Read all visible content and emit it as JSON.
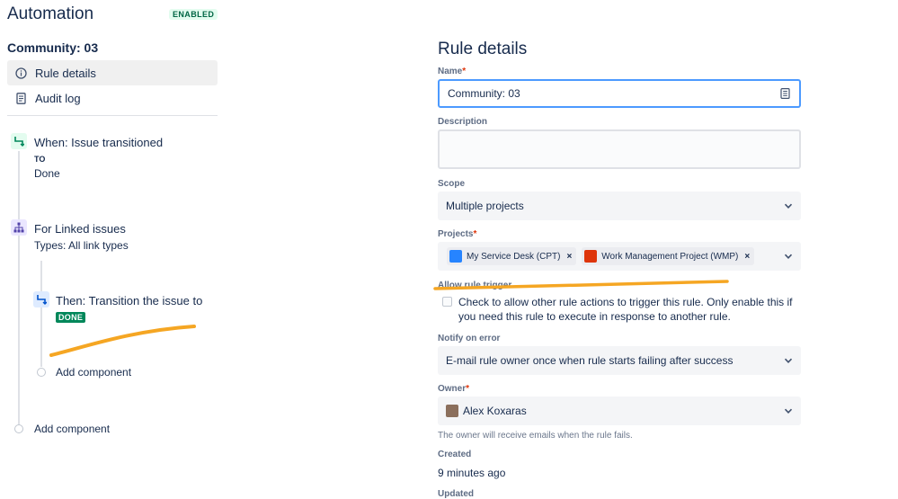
{
  "app": {
    "title": "Automation",
    "status_badge": "ENABLED"
  },
  "sidebar": {
    "rule_name": "Community: 03",
    "nav": [
      {
        "label": "Rule details",
        "icon": "info-icon"
      },
      {
        "label": "Audit log",
        "icon": "document-icon"
      }
    ]
  },
  "components": {
    "trigger": {
      "title": "When: Issue transitioned",
      "to_label": "TO",
      "to_value": "Done",
      "icon": "transition-icon"
    },
    "branch": {
      "title": "For Linked issues",
      "subtitle": "Types: All link types",
      "icon": "branch-icon"
    },
    "action": {
      "title": "Then: Transition the issue to",
      "status": "DONE",
      "icon": "transition-icon"
    },
    "add_inner": "Add component",
    "add_outer": "Add component"
  },
  "details": {
    "title": "Rule details",
    "name": {
      "label": "Name",
      "value": "Community: 03"
    },
    "description": {
      "label": "Description",
      "value": ""
    },
    "scope": {
      "label": "Scope",
      "value": "Multiple projects"
    },
    "projects": {
      "label": "Projects",
      "items": [
        {
          "label": "My Service Desk (CPT)",
          "color": "#2684ff"
        },
        {
          "label": "Work Management Project (WMP)",
          "color": "#de350b"
        }
      ]
    },
    "allow_trigger": {
      "label": "Allow rule trigger",
      "help": "Check to allow other rule actions to trigger this rule. Only enable this if you need this rule to execute in response to another rule.",
      "checked": false
    },
    "notify": {
      "label": "Notify on error",
      "value": "E-mail rule owner once when rule starts failing after success"
    },
    "owner": {
      "label": "Owner",
      "value": "Alex Koxaras",
      "note": "The owner will receive emails when the rule fails."
    },
    "created": {
      "label": "Created",
      "value": "9 minutes ago"
    },
    "updated": {
      "label": "Updated"
    }
  },
  "colors": {
    "accent": "#4c9aff",
    "success": "#00875a",
    "annotation": "#f5a623"
  }
}
